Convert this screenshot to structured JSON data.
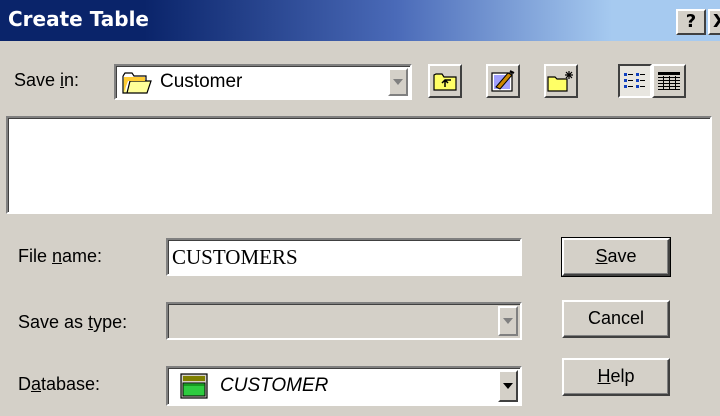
{
  "window": {
    "title": "Create Table",
    "help_glyph": "?",
    "close_glyph": "X"
  },
  "save_in": {
    "label_prefix": "Save ",
    "label_accel": "i",
    "label_suffix": "n:",
    "value": "Customer",
    "folder_icon": "open-folder-icon"
  },
  "toolbar": {
    "buttons": [
      {
        "name": "up-one-level",
        "icon": "up-folder-icon"
      },
      {
        "name": "desktop",
        "icon": "desktop-icon"
      },
      {
        "name": "new-folder",
        "icon": "new-folder-icon"
      },
      {
        "name": "list-view",
        "icon": "list-view-icon",
        "pressed": true
      },
      {
        "name": "details-view",
        "icon": "details-view-icon",
        "pressed": false
      }
    ]
  },
  "file_name": {
    "label_prefix": "File ",
    "label_accel": "n",
    "label_suffix": "ame:",
    "value": "CUSTOMERS"
  },
  "save_as_type": {
    "label_prefix": "Save as ",
    "label_accel": "t",
    "label_suffix": "ype:",
    "value": ""
  },
  "database": {
    "label_prefix": "D",
    "label_accel": "a",
    "label_suffix": "tabase:",
    "value": "CUSTOMER",
    "icon": "database-icon"
  },
  "buttons": {
    "save": {
      "accel": "S",
      "rest": "ave"
    },
    "cancel": {
      "label": "Cancel"
    },
    "help": {
      "accel": "H",
      "rest": "elp"
    }
  },
  "colors": {
    "face": "#d4d0c8",
    "title_start": "#0a246a",
    "title_end": "#a6caf0",
    "db_icon": "#2ecc40"
  }
}
